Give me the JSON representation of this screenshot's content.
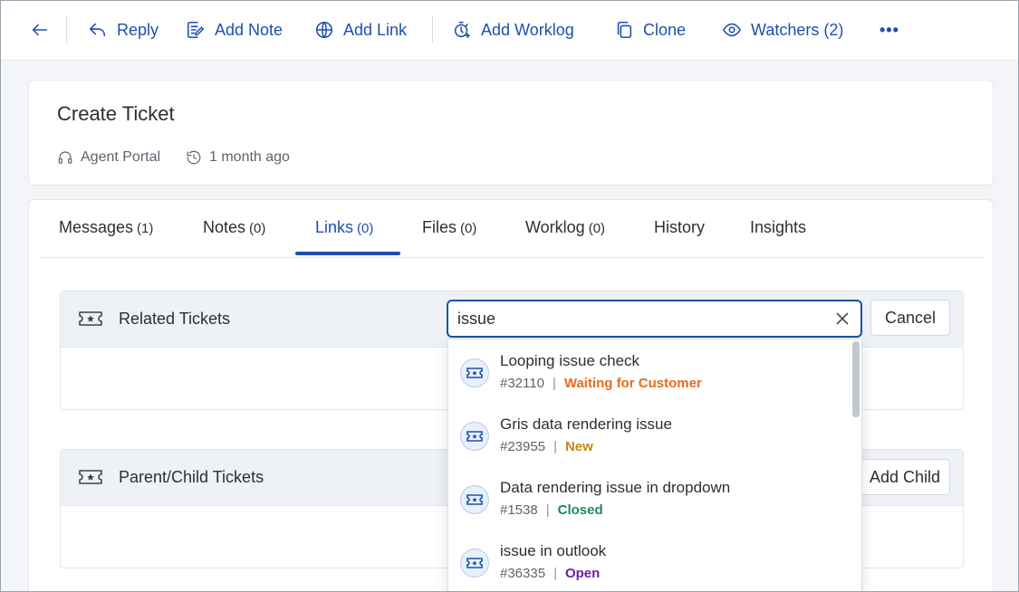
{
  "toolbar": {
    "back_label": "",
    "reply": "Reply",
    "add_note": "Add Note",
    "add_link": "Add Link",
    "add_worklog": "Add Worklog",
    "clone": "Clone",
    "watchers": "Watchers (2)",
    "more": "•••"
  },
  "ticket": {
    "title": "Create Ticket",
    "source": "Agent Portal",
    "time": "1 month ago"
  },
  "tabs": [
    {
      "label": "Messages",
      "count": "(1)"
    },
    {
      "label": "Notes",
      "count": "(0)"
    },
    {
      "label": "Links",
      "count": "(0)"
    },
    {
      "label": "Files",
      "count": "(0)"
    },
    {
      "label": "Worklog",
      "count": "(0)"
    },
    {
      "label": "History",
      "count": ""
    },
    {
      "label": "Insights",
      "count": ""
    }
  ],
  "active_tab": "Links",
  "related": {
    "title": "Related Tickets",
    "search_value": "issue",
    "cancel_label": "Cancel"
  },
  "parent_child": {
    "title": "Parent/Child Tickets",
    "add_child_label": "Add Child"
  },
  "results": [
    {
      "title": "Looping issue check",
      "id": "#32110",
      "status": "Waiting for Customer",
      "status_color": "#ea6a1f"
    },
    {
      "title": "Gris data rendering issue",
      "id": "#23955",
      "status": "New",
      "status_color": "#c18a12"
    },
    {
      "title": "Data rendering issue in dropdown",
      "id": "#1538",
      "status": "Closed",
      "status_color": "#1e8a55"
    },
    {
      "title": "issue in outlook",
      "id": "#36335",
      "status": "Open",
      "status_color": "#6b1fa8"
    }
  ],
  "colors": {
    "accent": "#1d4fae"
  }
}
